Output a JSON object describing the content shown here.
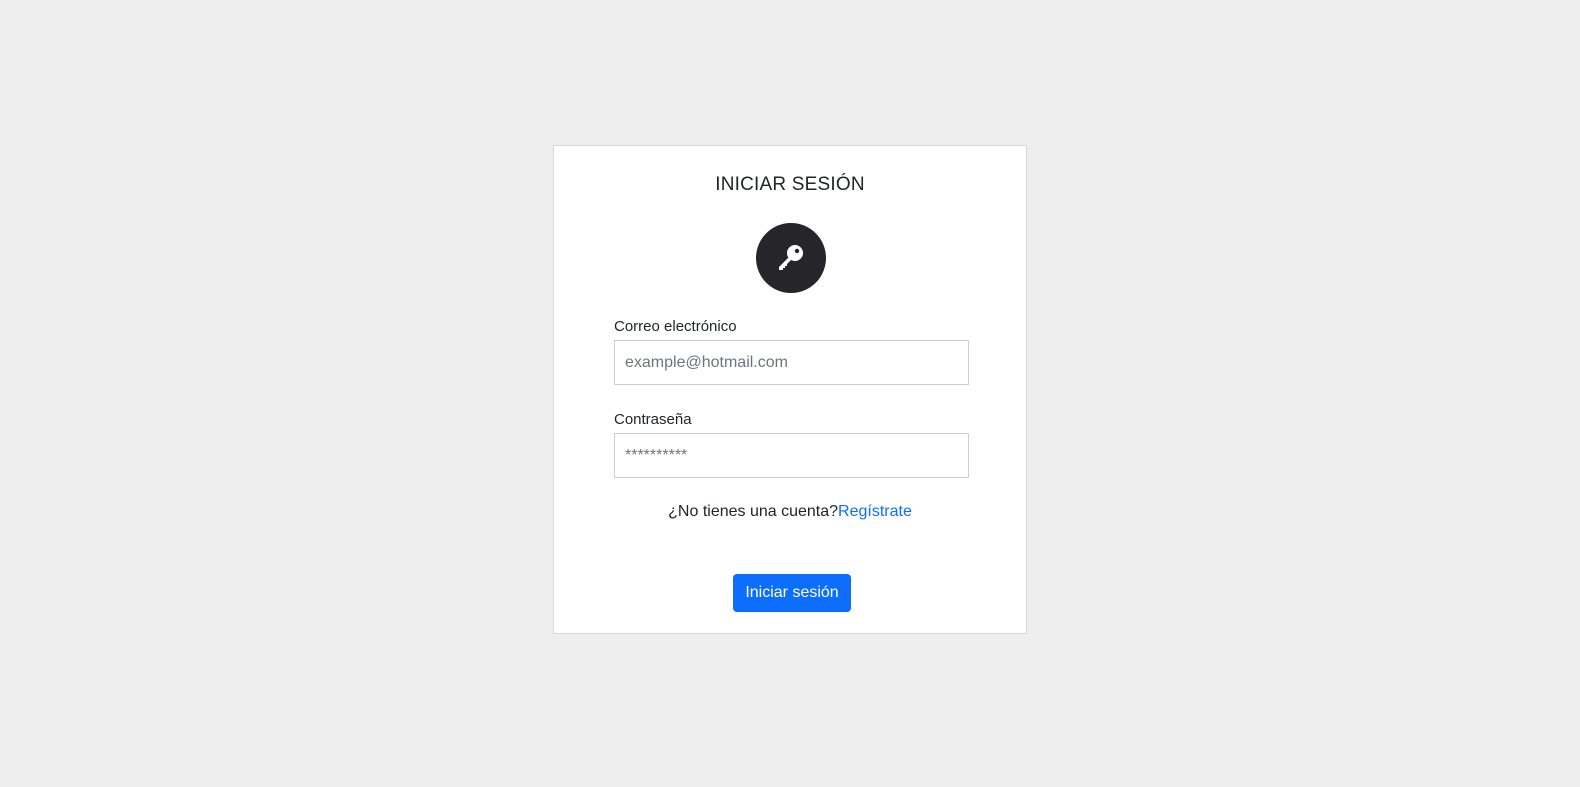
{
  "login": {
    "title": "INICIAR SESIÓN",
    "avatar_icon": "key-icon",
    "email": {
      "label": "Correo electrónico",
      "placeholder": "example@hotmail.com",
      "value": ""
    },
    "password": {
      "label": "Contraseña",
      "placeholder": "**********",
      "value": ""
    },
    "register_prompt": "¿No tienes una cuenta?",
    "register_link": "Regístrate",
    "submit_label": "Iniciar sesión"
  },
  "colors": {
    "background": "#eeeeee",
    "card": "#ffffff",
    "avatar": "#25252a",
    "primary": "#0d6efd",
    "text": "#212529"
  }
}
